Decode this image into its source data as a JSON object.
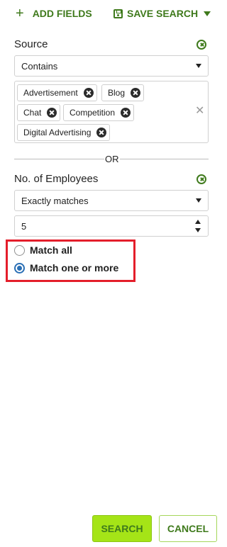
{
  "toolbar": {
    "add_fields_label": "ADD FIELDS",
    "save_search_label": "SAVE SEARCH"
  },
  "source_filter": {
    "label": "Source",
    "operator": "Contains",
    "tags": [
      {
        "label": "Advertisement"
      },
      {
        "label": "Blog"
      },
      {
        "label": "Chat"
      },
      {
        "label": "Competition"
      },
      {
        "label": "Digital Advertising"
      }
    ]
  },
  "divider": {
    "label": "OR"
  },
  "employees_filter": {
    "label": "No. of Employees",
    "operator": "Exactly matches",
    "value": "5"
  },
  "match_mode": {
    "options": [
      {
        "label": "Match all",
        "checked": false
      },
      {
        "label": "Match one or more",
        "checked": true
      }
    ]
  },
  "actions": {
    "search_label": "SEARCH",
    "cancel_label": "CANCEL"
  },
  "colors": {
    "accent": "#3f7a1c",
    "search_bg": "#a5e417",
    "radio_selected": "#2a6fb5",
    "highlight": "#e41e2b"
  }
}
